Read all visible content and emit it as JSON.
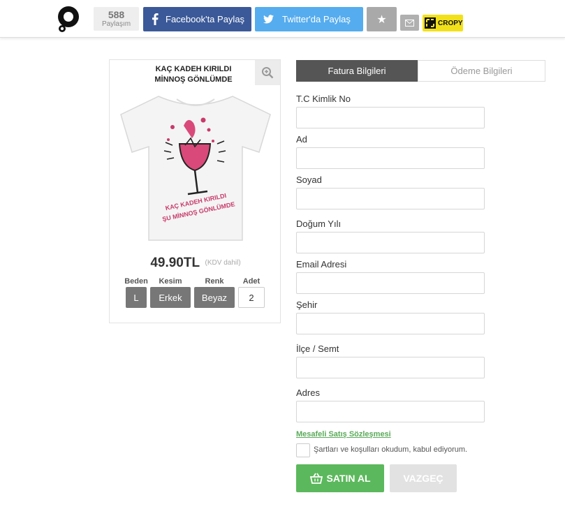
{
  "header": {
    "share_count": "588",
    "share_label": "Paylaşım",
    "facebook_label": "Facebook'ta Paylaş",
    "twitter_label": "Twitter'da Paylaş",
    "cropy_label": "CROPY",
    "colors": {
      "facebook": "#3b5998",
      "twitter": "#55acee",
      "cropy": "#f2e11a"
    }
  },
  "product": {
    "title_line1": "KAÇ KADEH KIRILDI",
    "title_line2": "MİNNOŞ GÖNLÜMDE",
    "shirt_text_line1": "KAÇ KADEH KIRILDI",
    "shirt_text_line2": "ŞU MİNNOŞ GÖNLÜMDE",
    "price": "49.90TL",
    "price_note": "(KDV dahil)",
    "options": {
      "size_label": "Beden",
      "size_value": "L",
      "cut_label": "Kesim",
      "cut_value": "Erkek",
      "color_label": "Renk",
      "color_value": "Beyaz",
      "qty_label": "Adet",
      "qty_value": "2"
    }
  },
  "tabs": {
    "billing": "Fatura Bilgileri",
    "payment": "Ödeme Bilgileri"
  },
  "form": {
    "tc_label": "T.C Kimlik No",
    "name_label": "Ad",
    "surname_label": "Soyad",
    "birth_label": "Doğum Yılı",
    "email_label": "Email Adresi",
    "city_label": "Şehir",
    "district_label": "İlçe / Semt",
    "address_label": "Adres",
    "contract_link": "Mesafeli Satış Sözleşmesi",
    "terms_text": "Şartları ve koşulları okudum, kabul ediyorum.",
    "buy_button": "SATIN AL",
    "cancel_button": "VAZGEÇ"
  }
}
